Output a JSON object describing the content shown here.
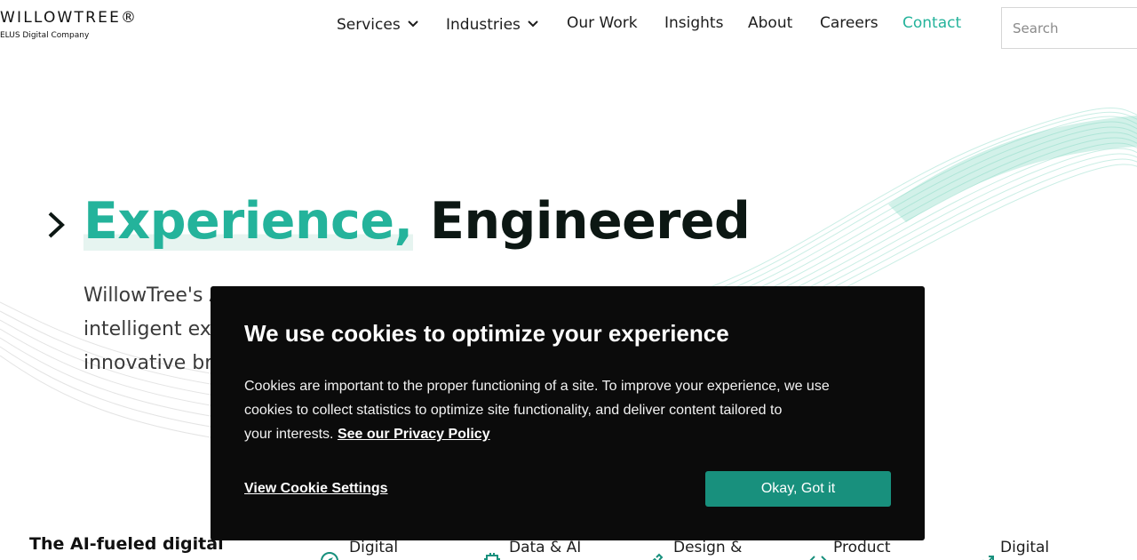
{
  "brand": {
    "logo_text": "WILLOWTREE®",
    "logo_sub": "ELUS Digital Company"
  },
  "nav": {
    "items": [
      {
        "label": "Services",
        "dropdown": true
      },
      {
        "label": "Industries",
        "dropdown": true
      },
      {
        "label": "Our Work",
        "dropdown": false
      },
      {
        "label": "Insights",
        "dropdown": false
      },
      {
        "label": "About",
        "dropdown": false
      },
      {
        "label": "Careers",
        "dropdown": false
      },
      {
        "label": "Contact",
        "dropdown": false
      }
    ],
    "search_placeholder": "Search"
  },
  "hero": {
    "title_accent": "Experience,",
    "title_rest": "Engineered",
    "desc_lines": [
      "WillowTree's A",
      "intelligent exp",
      "innovative bra"
    ]
  },
  "bottom": {
    "title": "The AI-fueled digital",
    "capabilities": [
      {
        "label": "Digital",
        "icon": "compass-icon"
      },
      {
        "label": "Data & AI",
        "icon": "chip-icon"
      },
      {
        "label": "Design &",
        "icon": "pen-icon"
      },
      {
        "label": "Product",
        "icon": "code-icon"
      },
      {
        "label": "Digital",
        "icon": "trend-icon"
      }
    ]
  },
  "cookie": {
    "title": "We use cookies to optimize your experience",
    "body_lines": [
      "Cookies are important to the proper functioning of a site. To improve your experience, we use",
      "cookies to collect statistics to optimize site functionality, and deliver content tailored to",
      "your interests."
    ],
    "privacy_link": "See our Privacy Policy",
    "settings_label": "View Cookie Settings",
    "ok_label": "Okay, Got it"
  },
  "colors": {
    "accent": "#24b39b",
    "button": "#18907d",
    "modal_bg": "#0b0b0b"
  }
}
